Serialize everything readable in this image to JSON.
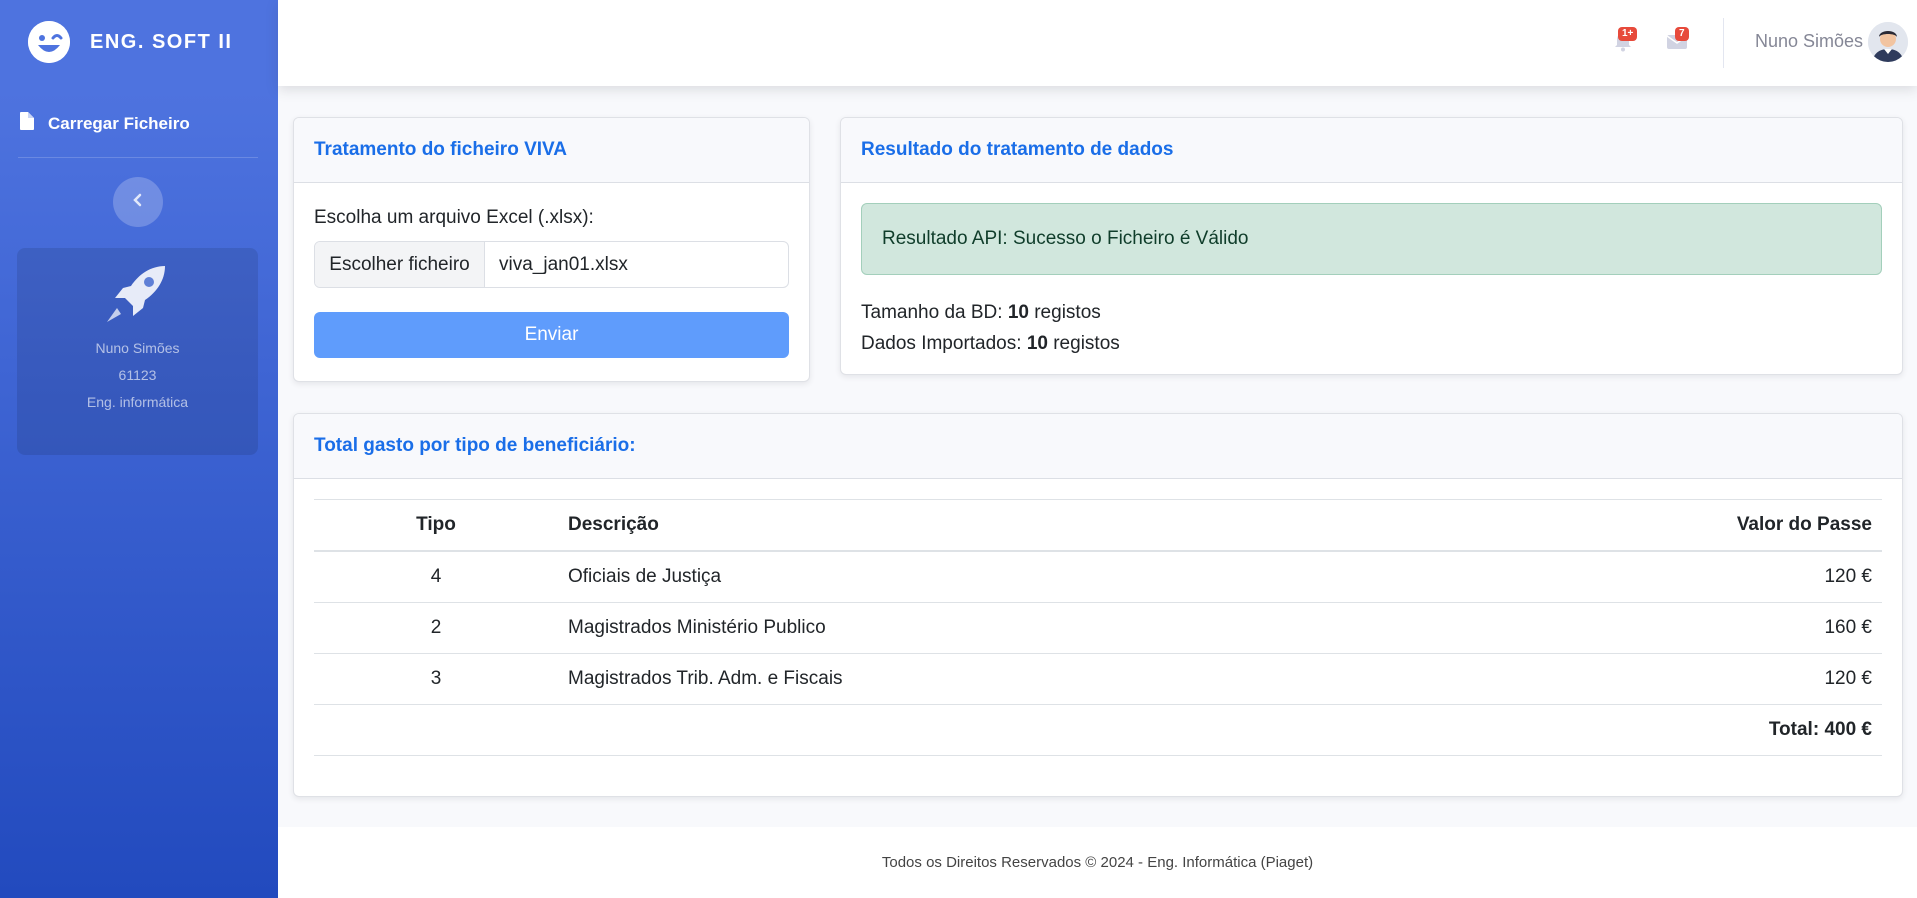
{
  "sidebar": {
    "brand": "ENG. SOFT II",
    "nav_item": "Carregar Ficheiro",
    "profile": {
      "name": "Nuno Simões",
      "number": "61123",
      "course": "Eng. informática"
    }
  },
  "topbar": {
    "alerts_badge": "1+",
    "messages_badge": "7",
    "user_name": "Nuno Simões"
  },
  "upload_card": {
    "title": "Tratamento do ficheiro VIVA",
    "label": "Escolha um arquivo Excel (.xlsx):",
    "choose_button": "Escolher ficheiro",
    "file_name": "viva_jan01.xlsx",
    "submit": "Enviar"
  },
  "result_card": {
    "title": "Resultado do tratamento de dados",
    "alert": "Resultado API: Sucesso o Ficheiro é Válido",
    "db_size_label": "Tamanho da BD:",
    "db_size_value": "10",
    "db_size_unit": "registos",
    "imported_label": "Dados Importados:",
    "imported_value": "10",
    "imported_unit": "registos"
  },
  "table_card": {
    "title": "Total gasto por tipo de beneficiário:",
    "headers": [
      "Tipo",
      "Descrição",
      "Valor do Passe"
    ],
    "rows": [
      {
        "tipo": "4",
        "descricao": "Oficiais de Justiça",
        "valor": "120 €"
      },
      {
        "tipo": "2",
        "descricao": "Magistrados Ministério Publico",
        "valor": "160 €"
      },
      {
        "tipo": "3",
        "descricao": "Magistrados Trib. Adm. e Fiscais",
        "valor": "120 €"
      }
    ],
    "total": "Total: 400 €"
  },
  "footer": "Todos os Direitos Reservados © 2024 - Eng. Informática (Piaget)",
  "colors": {
    "sidebar_top": "#4e73df",
    "sidebar_bottom": "#224abe",
    "header_text": "#1a6ee8",
    "alert_bg": "#d1e7dd",
    "button_bg": "#5f9cfc",
    "badge": "#e74a3b"
  }
}
